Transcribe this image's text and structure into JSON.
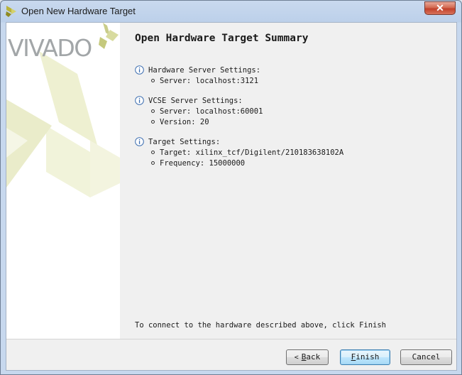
{
  "window": {
    "title": "Open New Hardware Target",
    "close_label": "✕"
  },
  "branding": {
    "logo_text": "VIVADO",
    "logo_colors": {
      "text": "#9ea3a6",
      "leaf_dark": "#c5c98a",
      "leaf_light": "#e6e8bd"
    }
  },
  "summary": {
    "heading": "Open Hardware Target Summary",
    "sections": [
      {
        "title": "Hardware Server Settings:",
        "items": [
          "Server: localhost:3121"
        ]
      },
      {
        "title": "VCSE Server Settings:",
        "items": [
          "Server: localhost:60001",
          "Version: 20"
        ]
      },
      {
        "title": "Target Settings:",
        "items": [
          "Target: xilinx_tcf/Digilent/210183638102A",
          "Frequency: 15000000"
        ]
      }
    ],
    "footer_note": "To connect to the hardware described above, click Finish"
  },
  "buttons": {
    "back": {
      "arrow": "<",
      "mnemonic": "B",
      "rest": "ack"
    },
    "finish": {
      "mnemonic": "F",
      "rest": "inish"
    },
    "cancel": {
      "label": "Cancel"
    }
  },
  "icons": {
    "info": "info-icon",
    "app": "vivado-app-icon",
    "close": "close-icon"
  }
}
